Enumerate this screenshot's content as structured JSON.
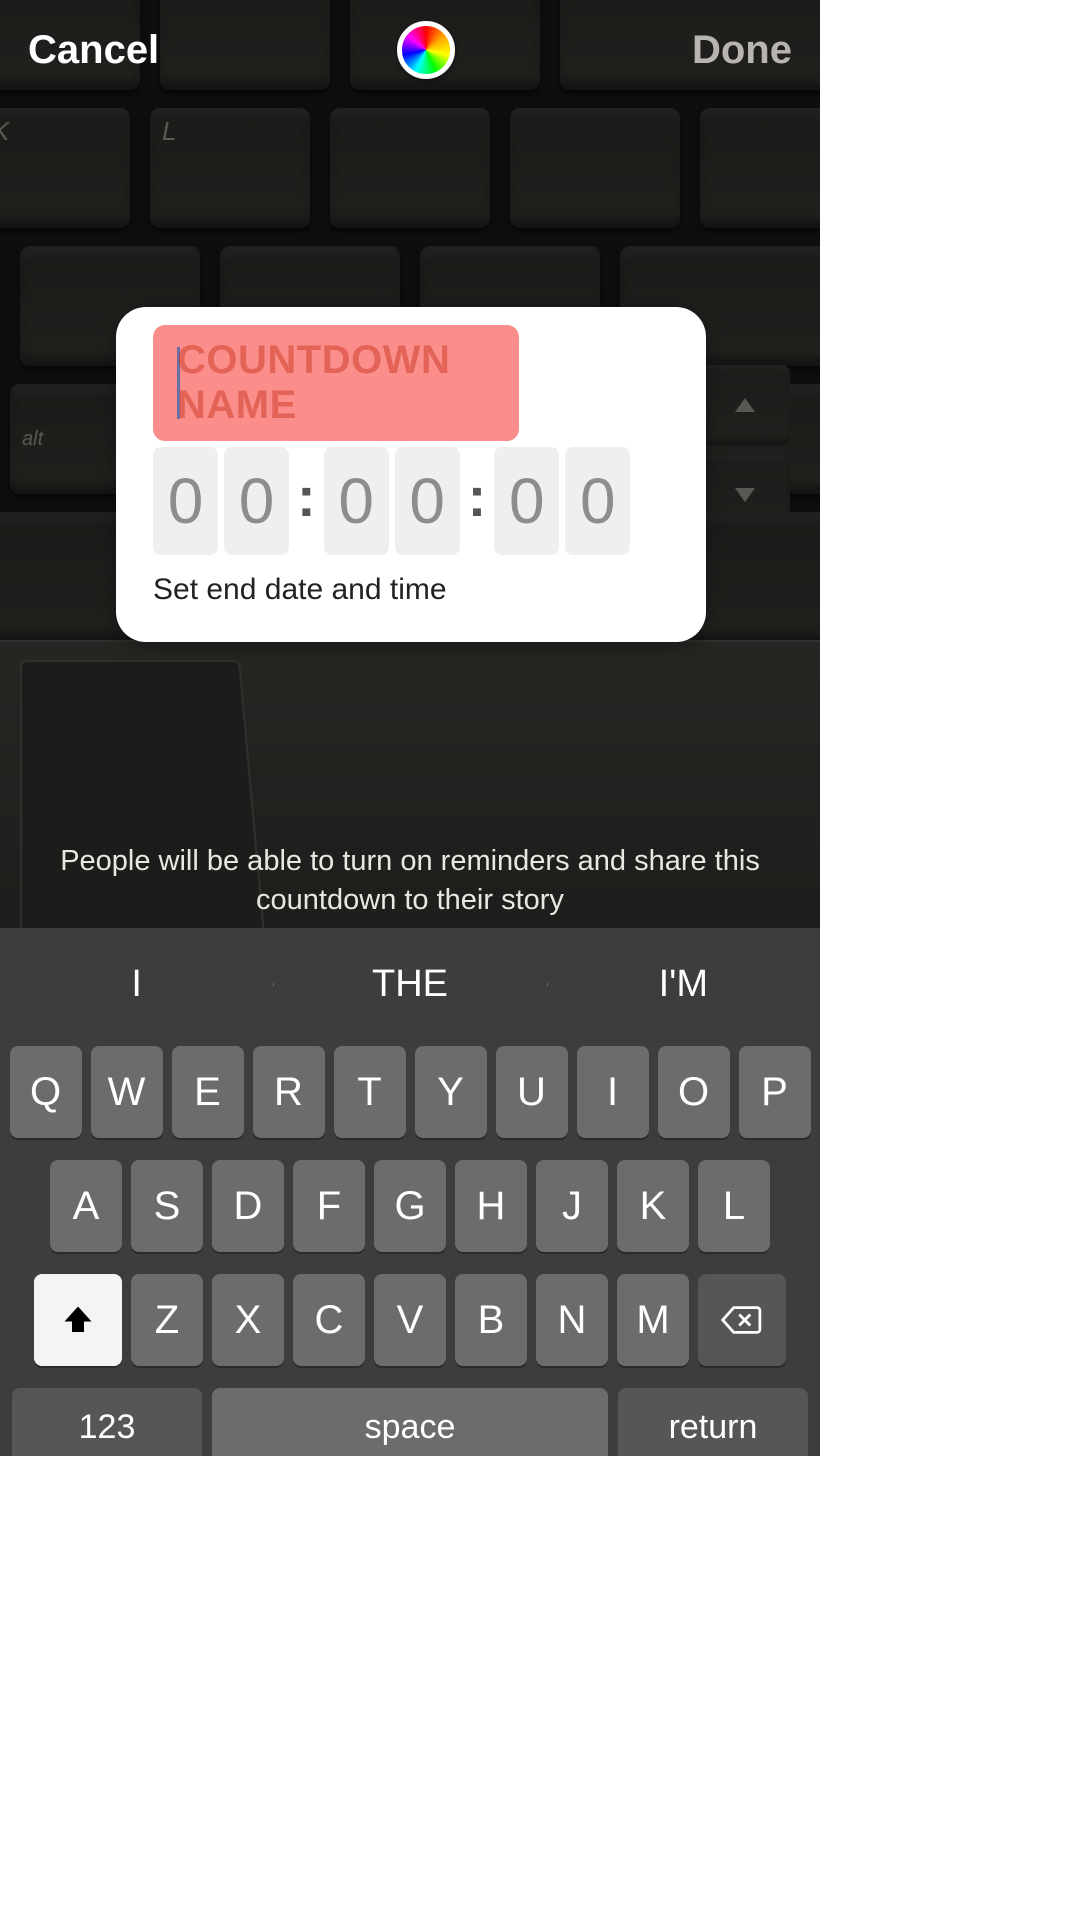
{
  "topbar": {
    "cancel": "Cancel",
    "done": "Done"
  },
  "countdown": {
    "name_placeholder": "COUNTDOWN NAME",
    "digits": [
      "0",
      "0",
      "0",
      "0",
      "0",
      "0"
    ],
    "set_end_label": "Set end date and time"
  },
  "helper_text": "People will be able to turn on reminders and share this countdown to their story",
  "keyboard": {
    "suggestions": [
      "I",
      "THE",
      "I'M"
    ],
    "row1": [
      "Q",
      "W",
      "E",
      "R",
      "T",
      "Y",
      "U",
      "I",
      "O",
      "P"
    ],
    "row2": [
      "A",
      "S",
      "D",
      "F",
      "G",
      "H",
      "J",
      "K",
      "L"
    ],
    "row3": [
      "Z",
      "X",
      "C",
      "V",
      "B",
      "N",
      "M"
    ],
    "numeric_label": "123",
    "space_label": "space",
    "return_label": "return"
  },
  "bg_keys": {
    "alt": "alt",
    "k": "K",
    "l": "L"
  }
}
